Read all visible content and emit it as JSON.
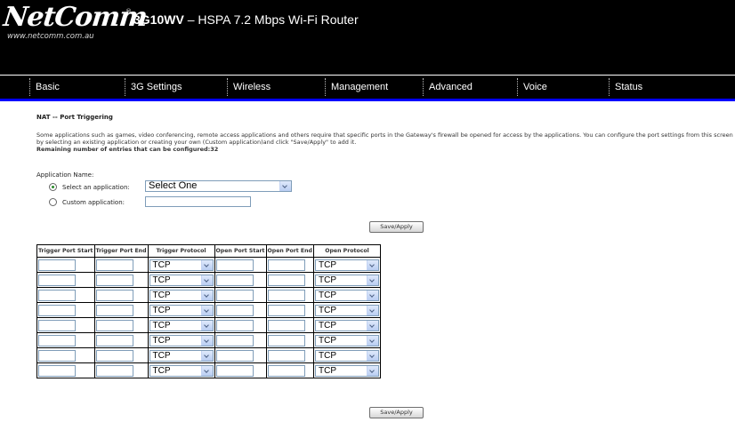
{
  "header": {
    "logo_text": "NetComm",
    "logo_reg": "®",
    "logo_url": "www.netcomm.com.au",
    "model": "3G10WV",
    "model_desc": " – HSPA 7.2 Mbps Wi-Fi Router"
  },
  "nav": {
    "items": [
      {
        "label": "Basic"
      },
      {
        "label": "3G Settings"
      },
      {
        "label": "Wireless"
      },
      {
        "label": "Management"
      },
      {
        "label": "Advanced"
      },
      {
        "label": "Voice"
      },
      {
        "label": "Status"
      }
    ]
  },
  "page": {
    "title": "NAT -- Port Triggering",
    "description": "Some applications such as games, video conferencing, remote access applications and others require that specific ports in the Gateway's firewall be opened for access by the applications. You can configure the port settings from this screen by selecting an existing application or creating your own (Custom application)and click \"Save/Apply\" to add it.",
    "remaining": "Remaining number of entries that can be configured:32",
    "app_name_label": "Application Name:",
    "select_app_label": "Select an application:",
    "select_app_value": "Select One",
    "custom_app_label": "Custom application:",
    "custom_app_value": "",
    "save_apply_label": "Save/Apply"
  },
  "table": {
    "headers": [
      "Trigger Port Start",
      "Trigger Port End",
      "Trigger Protocol",
      "Open Port Start",
      "Open Port End",
      "Open Protocol"
    ],
    "rows": [
      {
        "trigger_protocol": "TCP",
        "open_protocol": "TCP"
      },
      {
        "trigger_protocol": "TCP",
        "open_protocol": "TCP"
      },
      {
        "trigger_protocol": "TCP",
        "open_protocol": "TCP"
      },
      {
        "trigger_protocol": "TCP",
        "open_protocol": "TCP"
      },
      {
        "trigger_protocol": "TCP",
        "open_protocol": "TCP"
      },
      {
        "trigger_protocol": "TCP",
        "open_protocol": "TCP"
      },
      {
        "trigger_protocol": "TCP",
        "open_protocol": "TCP"
      },
      {
        "trigger_protocol": "TCP",
        "open_protocol": "TCP"
      }
    ]
  },
  "colors": {
    "header_bg": "#000000",
    "accent_line": "#0000ff",
    "radio_checked": "#2a8a2a"
  }
}
